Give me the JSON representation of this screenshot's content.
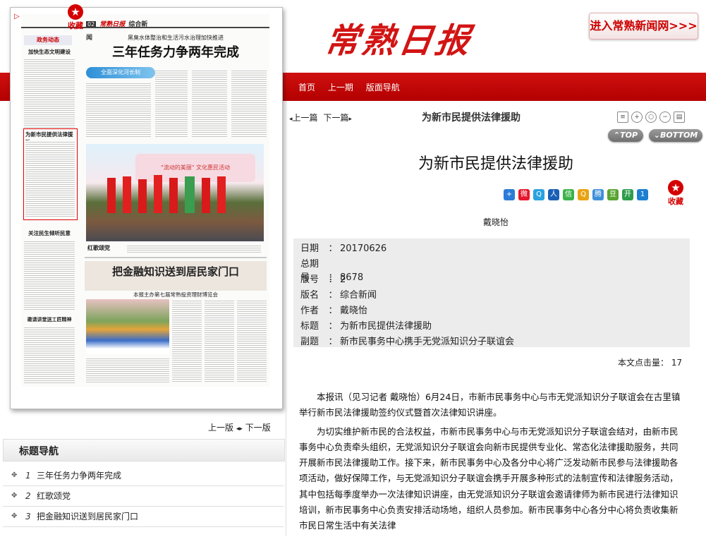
{
  "header": {
    "masthead": "常熟日报",
    "enter_link": "进入常熟新闻网>>>",
    "nav": [
      "首页",
      "上一期",
      "版面导航"
    ]
  },
  "newspaper": {
    "favorite_label": "收藏",
    "page_prev": "上一版",
    "page_next": "下一版",
    "edition_label": "综合新闻",
    "headline_kicker": "黑臭水体整治和生活污水治理加快推进",
    "headline": "三年任务力争两年完成",
    "sub_headline": "把金融知识送到居民家门口",
    "sub_kicker": "本报主办第七届常熟投资理财博览会",
    "photo_caption": "红歌颂党",
    "col_item1": "加快生态文明建设",
    "col_item2": "为新市民提供法律援助",
    "col_item3": "关注民生倾听民意",
    "col_item4": "邀请讲堂送工匠精神"
  },
  "sidebar": {
    "title": "标题导航",
    "items": [
      {
        "num": "1",
        "label": "三年任务力争两年完成"
      },
      {
        "num": "2",
        "label": "红歌颂党"
      },
      {
        "num": "3",
        "label": "把金融知识送到居民家门口"
      }
    ]
  },
  "article": {
    "prev_label": "上一篇",
    "next_label": "下一篇",
    "header_title": "为新市民提供法律援助",
    "top_label": "TOP",
    "bottom_label": "BOTTOM",
    "title": "为新市民提供法律援助",
    "favorite_label": "收藏",
    "author": "戴晓怡",
    "meta": [
      {
        "key": "日期",
        "value": "20170626"
      },
      {
        "key": "总期号",
        "value": "8678"
      },
      {
        "key": "版号",
        "value": "2"
      },
      {
        "key": "版名",
        "value": "综合新闻"
      },
      {
        "key": "作者",
        "value": "戴晓怡"
      },
      {
        "key": "标题",
        "value": "为新市民提供法律援助"
      },
      {
        "key": "副题",
        "value": "新市民事务中心携手无党派知识分子联谊会"
      }
    ],
    "hits_label": "本文点击量：",
    "hits_value": "17",
    "paragraphs": [
      "本报讯（见习记者 戴晓怡）6月24日，市新市民事务中心与市无党派知识分子联谊会在古里镇举行新市民法律援助签约仪式暨首次法律知识讲座。",
      "为切实维护新市民的合法权益，市新市民事务中心与市无党派知识分子联谊会结对，由新市民事务中心负责牵头组织，无党派知识分子联谊会向新市民提供专业化、常态化法律援助服务，共同开展新市民法律援助工作。接下来，新市民事务中心及各分中心将广泛发动新市民参与法律援助各项活动，做好保障工作，与无党派知识分子联谊会携手开展多种形式的法制宣传和法律服务活动，其中包括每季度举办一次法律知识讲座，由无党派知识分子联谊会邀请律师为新市民进行法律知识培训，新市民事务中心负责安排活动场地，组织人员参加。新市民事务中心各分中心将负责收集新市民日常生活中有关法律"
    ]
  },
  "colors": {
    "brand_red": "#d21414",
    "nav_band": "#c00000",
    "meta_bg": "#ececec"
  }
}
